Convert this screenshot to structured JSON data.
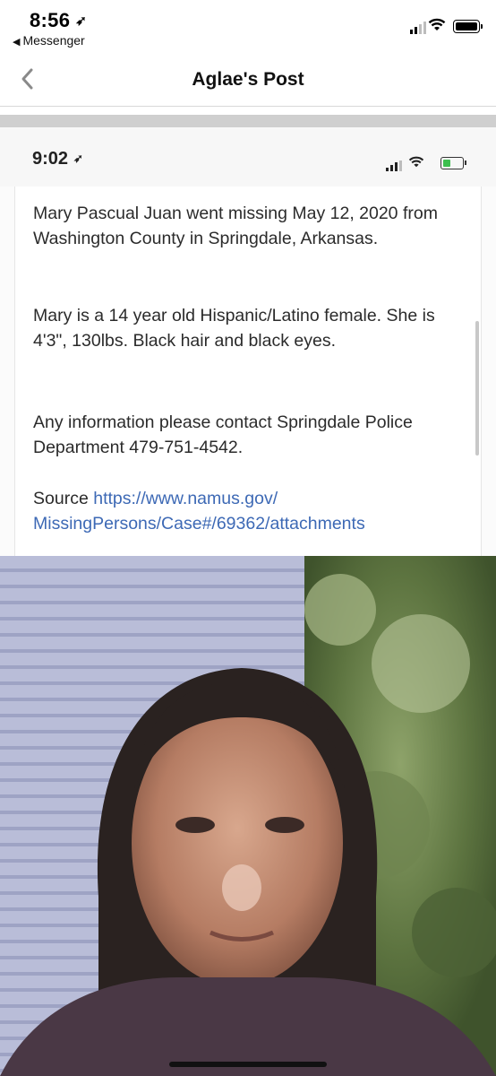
{
  "status_bar": {
    "time": "8:56",
    "back_app": "Messenger"
  },
  "navbar": {
    "title": "Aglae's Post"
  },
  "embedded_screenshot": {
    "time": "9:02",
    "post": {
      "paragraph_1": "Mary Pascual Juan went missing May 12, 2020 from Washington County in Springdale, Arkansas.",
      "paragraph_2": "Mary is a 14 year old Hispanic/Latino female. She is 4'3\", 130lbs. Black hair and black eyes.",
      "paragraph_3": "Any information please contact Springdale Police Department 479-751-4542.",
      "source_label": "Source",
      "source_link": "https://www.namus.gov/MissingPersons/Case#/69362/attachments",
      "source_link_line1": "https://www.namus.gov/",
      "source_link_line2": "MissingPersons/Case#/69362/attachments"
    }
  },
  "colors": {
    "link": "#3d69b5",
    "battery_charge": "#3cbf4e",
    "divider": "#cfcfcf"
  },
  "icons": [
    "location-arrow-icon",
    "back-triangle-icon",
    "signal-icon",
    "wifi-icon",
    "battery-icon",
    "chevron-left-icon"
  ]
}
